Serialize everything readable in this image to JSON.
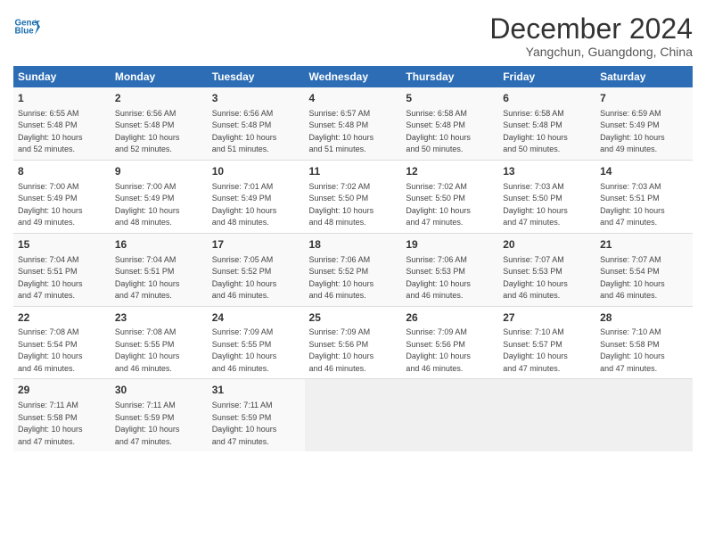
{
  "logo": {
    "line1": "General",
    "line2": "Blue"
  },
  "header": {
    "month": "December 2024",
    "location": "Yangchun, Guangdong, China"
  },
  "weekdays": [
    "Sunday",
    "Monday",
    "Tuesday",
    "Wednesday",
    "Thursday",
    "Friday",
    "Saturday"
  ],
  "weeks": [
    [
      {
        "day": "1",
        "sunrise": "6:55 AM",
        "sunset": "5:48 PM",
        "daylight": "10 hours and 52 minutes."
      },
      {
        "day": "2",
        "sunrise": "6:56 AM",
        "sunset": "5:48 PM",
        "daylight": "10 hours and 52 minutes."
      },
      {
        "day": "3",
        "sunrise": "6:56 AM",
        "sunset": "5:48 PM",
        "daylight": "10 hours and 51 minutes."
      },
      {
        "day": "4",
        "sunrise": "6:57 AM",
        "sunset": "5:48 PM",
        "daylight": "10 hours and 51 minutes."
      },
      {
        "day": "5",
        "sunrise": "6:58 AM",
        "sunset": "5:48 PM",
        "daylight": "10 hours and 50 minutes."
      },
      {
        "day": "6",
        "sunrise": "6:58 AM",
        "sunset": "5:48 PM",
        "daylight": "10 hours and 50 minutes."
      },
      {
        "day": "7",
        "sunrise": "6:59 AM",
        "sunset": "5:49 PM",
        "daylight": "10 hours and 49 minutes."
      }
    ],
    [
      {
        "day": "8",
        "sunrise": "7:00 AM",
        "sunset": "5:49 PM",
        "daylight": "10 hours and 49 minutes."
      },
      {
        "day": "9",
        "sunrise": "7:00 AM",
        "sunset": "5:49 PM",
        "daylight": "10 hours and 48 minutes."
      },
      {
        "day": "10",
        "sunrise": "7:01 AM",
        "sunset": "5:49 PM",
        "daylight": "10 hours and 48 minutes."
      },
      {
        "day": "11",
        "sunrise": "7:02 AM",
        "sunset": "5:50 PM",
        "daylight": "10 hours and 48 minutes."
      },
      {
        "day": "12",
        "sunrise": "7:02 AM",
        "sunset": "5:50 PM",
        "daylight": "10 hours and 47 minutes."
      },
      {
        "day": "13",
        "sunrise": "7:03 AM",
        "sunset": "5:50 PM",
        "daylight": "10 hours and 47 minutes."
      },
      {
        "day": "14",
        "sunrise": "7:03 AM",
        "sunset": "5:51 PM",
        "daylight": "10 hours and 47 minutes."
      }
    ],
    [
      {
        "day": "15",
        "sunrise": "7:04 AM",
        "sunset": "5:51 PM",
        "daylight": "10 hours and 47 minutes."
      },
      {
        "day": "16",
        "sunrise": "7:04 AM",
        "sunset": "5:51 PM",
        "daylight": "10 hours and 47 minutes."
      },
      {
        "day": "17",
        "sunrise": "7:05 AM",
        "sunset": "5:52 PM",
        "daylight": "10 hours and 46 minutes."
      },
      {
        "day": "18",
        "sunrise": "7:06 AM",
        "sunset": "5:52 PM",
        "daylight": "10 hours and 46 minutes."
      },
      {
        "day": "19",
        "sunrise": "7:06 AM",
        "sunset": "5:53 PM",
        "daylight": "10 hours and 46 minutes."
      },
      {
        "day": "20",
        "sunrise": "7:07 AM",
        "sunset": "5:53 PM",
        "daylight": "10 hours and 46 minutes."
      },
      {
        "day": "21",
        "sunrise": "7:07 AM",
        "sunset": "5:54 PM",
        "daylight": "10 hours and 46 minutes."
      }
    ],
    [
      {
        "day": "22",
        "sunrise": "7:08 AM",
        "sunset": "5:54 PM",
        "daylight": "10 hours and 46 minutes."
      },
      {
        "day": "23",
        "sunrise": "7:08 AM",
        "sunset": "5:55 PM",
        "daylight": "10 hours and 46 minutes."
      },
      {
        "day": "24",
        "sunrise": "7:09 AM",
        "sunset": "5:55 PM",
        "daylight": "10 hours and 46 minutes."
      },
      {
        "day": "25",
        "sunrise": "7:09 AM",
        "sunset": "5:56 PM",
        "daylight": "10 hours and 46 minutes."
      },
      {
        "day": "26",
        "sunrise": "7:09 AM",
        "sunset": "5:56 PM",
        "daylight": "10 hours and 46 minutes."
      },
      {
        "day": "27",
        "sunrise": "7:10 AM",
        "sunset": "5:57 PM",
        "daylight": "10 hours and 47 minutes."
      },
      {
        "day": "28",
        "sunrise": "7:10 AM",
        "sunset": "5:58 PM",
        "daylight": "10 hours and 47 minutes."
      }
    ],
    [
      {
        "day": "29",
        "sunrise": "7:11 AM",
        "sunset": "5:58 PM",
        "daylight": "10 hours and 47 minutes."
      },
      {
        "day": "30",
        "sunrise": "7:11 AM",
        "sunset": "5:59 PM",
        "daylight": "10 hours and 47 minutes."
      },
      {
        "day": "31",
        "sunrise": "7:11 AM",
        "sunset": "5:59 PM",
        "daylight": "10 hours and 47 minutes."
      },
      null,
      null,
      null,
      null
    ]
  ],
  "labels": {
    "sunrise": "Sunrise:",
    "sunset": "Sunset:",
    "daylight": "Daylight:"
  }
}
